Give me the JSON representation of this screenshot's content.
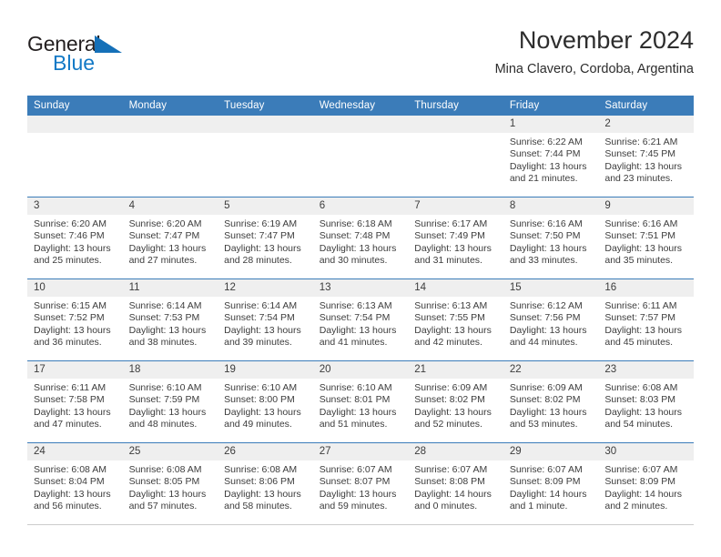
{
  "brand": {
    "name_part1": "General",
    "name_part2": "Blue",
    "logo_icon": "blue-triangle-icon"
  },
  "header": {
    "title": "November 2024",
    "subtitle": "Mina Clavero, Cordoba, Argentina"
  },
  "calendar": {
    "weekdays": [
      "Sunday",
      "Monday",
      "Tuesday",
      "Wednesday",
      "Thursday",
      "Friday",
      "Saturday"
    ],
    "colors": {
      "header_blue": "#3b7cb9",
      "daynum_bg": "#efefef",
      "brand_blue": "#1279c6",
      "text": "#3c3c3c"
    },
    "labels": {
      "sunrise": "Sunrise:",
      "sunset": "Sunset:",
      "daylight": "Daylight:"
    },
    "weeks": [
      [
        {
          "day": "",
          "empty": true
        },
        {
          "day": "",
          "empty": true
        },
        {
          "day": "",
          "empty": true
        },
        {
          "day": "",
          "empty": true
        },
        {
          "day": "",
          "empty": true
        },
        {
          "day": "1",
          "sunrise": "Sunrise: 6:22 AM",
          "sunset": "Sunset: 7:44 PM",
          "daylight": "Daylight: 13 hours and 21 minutes."
        },
        {
          "day": "2",
          "sunrise": "Sunrise: 6:21 AM",
          "sunset": "Sunset: 7:45 PM",
          "daylight": "Daylight: 13 hours and 23 minutes."
        }
      ],
      [
        {
          "day": "3",
          "sunrise": "Sunrise: 6:20 AM",
          "sunset": "Sunset: 7:46 PM",
          "daylight": "Daylight: 13 hours and 25 minutes."
        },
        {
          "day": "4",
          "sunrise": "Sunrise: 6:20 AM",
          "sunset": "Sunset: 7:47 PM",
          "daylight": "Daylight: 13 hours and 27 minutes."
        },
        {
          "day": "5",
          "sunrise": "Sunrise: 6:19 AM",
          "sunset": "Sunset: 7:47 PM",
          "daylight": "Daylight: 13 hours and 28 minutes."
        },
        {
          "day": "6",
          "sunrise": "Sunrise: 6:18 AM",
          "sunset": "Sunset: 7:48 PM",
          "daylight": "Daylight: 13 hours and 30 minutes."
        },
        {
          "day": "7",
          "sunrise": "Sunrise: 6:17 AM",
          "sunset": "Sunset: 7:49 PM",
          "daylight": "Daylight: 13 hours and 31 minutes."
        },
        {
          "day": "8",
          "sunrise": "Sunrise: 6:16 AM",
          "sunset": "Sunset: 7:50 PM",
          "daylight": "Daylight: 13 hours and 33 minutes."
        },
        {
          "day": "9",
          "sunrise": "Sunrise: 6:16 AM",
          "sunset": "Sunset: 7:51 PM",
          "daylight": "Daylight: 13 hours and 35 minutes."
        }
      ],
      [
        {
          "day": "10",
          "sunrise": "Sunrise: 6:15 AM",
          "sunset": "Sunset: 7:52 PM",
          "daylight": "Daylight: 13 hours and 36 minutes."
        },
        {
          "day": "11",
          "sunrise": "Sunrise: 6:14 AM",
          "sunset": "Sunset: 7:53 PM",
          "daylight": "Daylight: 13 hours and 38 minutes."
        },
        {
          "day": "12",
          "sunrise": "Sunrise: 6:14 AM",
          "sunset": "Sunset: 7:54 PM",
          "daylight": "Daylight: 13 hours and 39 minutes."
        },
        {
          "day": "13",
          "sunrise": "Sunrise: 6:13 AM",
          "sunset": "Sunset: 7:54 PM",
          "daylight": "Daylight: 13 hours and 41 minutes."
        },
        {
          "day": "14",
          "sunrise": "Sunrise: 6:13 AM",
          "sunset": "Sunset: 7:55 PM",
          "daylight": "Daylight: 13 hours and 42 minutes."
        },
        {
          "day": "15",
          "sunrise": "Sunrise: 6:12 AM",
          "sunset": "Sunset: 7:56 PM",
          "daylight": "Daylight: 13 hours and 44 minutes."
        },
        {
          "day": "16",
          "sunrise": "Sunrise: 6:11 AM",
          "sunset": "Sunset: 7:57 PM",
          "daylight": "Daylight: 13 hours and 45 minutes."
        }
      ],
      [
        {
          "day": "17",
          "sunrise": "Sunrise: 6:11 AM",
          "sunset": "Sunset: 7:58 PM",
          "daylight": "Daylight: 13 hours and 47 minutes."
        },
        {
          "day": "18",
          "sunrise": "Sunrise: 6:10 AM",
          "sunset": "Sunset: 7:59 PM",
          "daylight": "Daylight: 13 hours and 48 minutes."
        },
        {
          "day": "19",
          "sunrise": "Sunrise: 6:10 AM",
          "sunset": "Sunset: 8:00 PM",
          "daylight": "Daylight: 13 hours and 49 minutes."
        },
        {
          "day": "20",
          "sunrise": "Sunrise: 6:10 AM",
          "sunset": "Sunset: 8:01 PM",
          "daylight": "Daylight: 13 hours and 51 minutes."
        },
        {
          "day": "21",
          "sunrise": "Sunrise: 6:09 AM",
          "sunset": "Sunset: 8:02 PM",
          "daylight": "Daylight: 13 hours and 52 minutes."
        },
        {
          "day": "22",
          "sunrise": "Sunrise: 6:09 AM",
          "sunset": "Sunset: 8:02 PM",
          "daylight": "Daylight: 13 hours and 53 minutes."
        },
        {
          "day": "23",
          "sunrise": "Sunrise: 6:08 AM",
          "sunset": "Sunset: 8:03 PM",
          "daylight": "Daylight: 13 hours and 54 minutes."
        }
      ],
      [
        {
          "day": "24",
          "sunrise": "Sunrise: 6:08 AM",
          "sunset": "Sunset: 8:04 PM",
          "daylight": "Daylight: 13 hours and 56 minutes."
        },
        {
          "day": "25",
          "sunrise": "Sunrise: 6:08 AM",
          "sunset": "Sunset: 8:05 PM",
          "daylight": "Daylight: 13 hours and 57 minutes."
        },
        {
          "day": "26",
          "sunrise": "Sunrise: 6:08 AM",
          "sunset": "Sunset: 8:06 PM",
          "daylight": "Daylight: 13 hours and 58 minutes."
        },
        {
          "day": "27",
          "sunrise": "Sunrise: 6:07 AM",
          "sunset": "Sunset: 8:07 PM",
          "daylight": "Daylight: 13 hours and 59 minutes."
        },
        {
          "day": "28",
          "sunrise": "Sunrise: 6:07 AM",
          "sunset": "Sunset: 8:08 PM",
          "daylight": "Daylight: 14 hours and 0 minutes."
        },
        {
          "day": "29",
          "sunrise": "Sunrise: 6:07 AM",
          "sunset": "Sunset: 8:09 PM",
          "daylight": "Daylight: 14 hours and 1 minute."
        },
        {
          "day": "30",
          "sunrise": "Sunrise: 6:07 AM",
          "sunset": "Sunset: 8:09 PM",
          "daylight": "Daylight: 14 hours and 2 minutes."
        }
      ]
    ]
  }
}
